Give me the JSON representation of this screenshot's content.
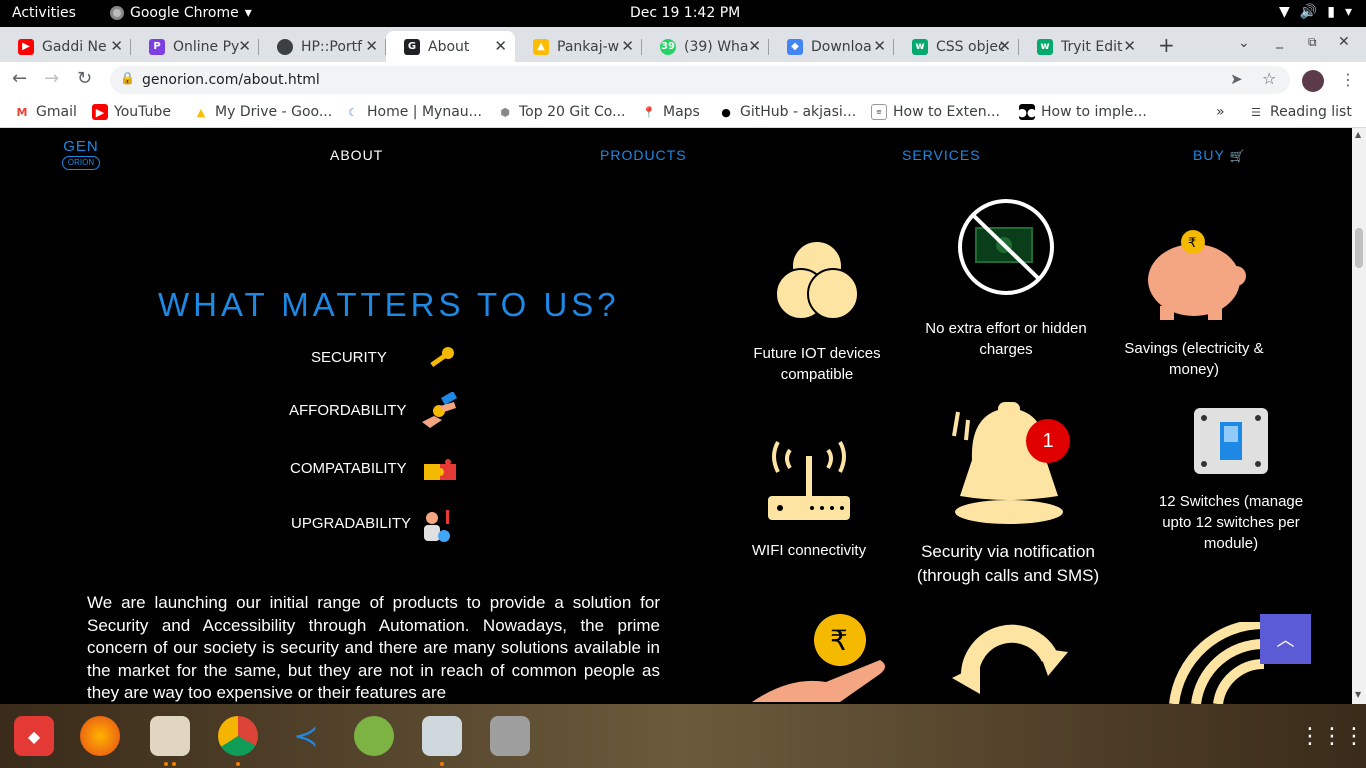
{
  "topbar": {
    "activities": "Activities",
    "app": "Google Chrome",
    "clock": "Dec 19  1:42 PM"
  },
  "tabs": [
    {
      "title": "Gaddi Ne",
      "icon": "youtube-icon",
      "color": "#ff0000"
    },
    {
      "title": "Online Py",
      "icon": "online-python-icon",
      "color": "#7b3fe4"
    },
    {
      "title": "HP::Portf",
      "icon": "globe-icon",
      "color": "#3c4043"
    },
    {
      "title": "About",
      "icon": "genorion-icon",
      "color": "#202124"
    },
    {
      "title": "Pankaj-w",
      "icon": "drive-icon",
      "color": "#fbbc04"
    },
    {
      "title": "(39) Wha",
      "icon": "whatsapp-icon",
      "color": "#25d366"
    },
    {
      "title": "Downloa",
      "icon": "download-icon",
      "color": "#4285f4"
    },
    {
      "title": "CSS objec",
      "icon": "w3schools-icon",
      "color": "#04aa6d"
    },
    {
      "title": "Tryit Edit",
      "icon": "w3schools-icon",
      "color": "#04aa6d"
    }
  ],
  "address": {
    "url": "genorion.com/about.html"
  },
  "bookmarks": [
    {
      "label": "Gmail",
      "icon": "gmail-icon"
    },
    {
      "label": "YouTube",
      "icon": "youtube-icon"
    },
    {
      "label": "My Drive - Goo...",
      "icon": "drive-icon"
    },
    {
      "label": "Home | Mynau...",
      "icon": "mynaukri-icon"
    },
    {
      "label": "Top 20 Git Co...",
      "icon": "git-icon"
    },
    {
      "label": "Maps",
      "icon": "maps-icon"
    },
    {
      "label": "GitHub - akjasi...",
      "icon": "github-icon"
    },
    {
      "label": "How to Exten...",
      "icon": "article-icon"
    },
    {
      "label": "How to imple...",
      "icon": "medium-icon"
    }
  ],
  "reading_list": "Reading list",
  "site": {
    "logo_top": "GEN",
    "logo_bottom": "ORION",
    "nav": {
      "about": "ABOUT",
      "products": "PRODUCTS",
      "services": "SERVICES",
      "buy": "BUY"
    },
    "headline": "WHAT MATTERS TO US?",
    "values": [
      {
        "label": "SECURITY",
        "icon": "key-icon"
      },
      {
        "label": "AFFORDABILITY",
        "icon": "money-hands-icon"
      },
      {
        "label": "COMPATABILITY",
        "icon": "puzzle-icon"
      },
      {
        "label": "UPGRADABILITY",
        "icon": "upgrade-person-icon"
      }
    ],
    "intro": "We are launching our initial range of products to provide a solution for Security and Accessibility through Automation. Nowadays, the prime concern of our society is security and there are many solutions available in the market for the same, but they are not in reach of common people as they are way too expensive or their features are",
    "features": {
      "iot": "Future IOT devices compatible",
      "charges": "No extra effort or hidden  charges",
      "savings": "Savings (electricity & money)",
      "wifi": "WIFI connectivity",
      "notification": "Security via notification (through calls and SMS)",
      "notification_badge": "1",
      "switches": "12 Switches  (manage upto 12 switches per module)"
    },
    "accent": "#1e88e5",
    "icon_color": "#fde4a3"
  }
}
